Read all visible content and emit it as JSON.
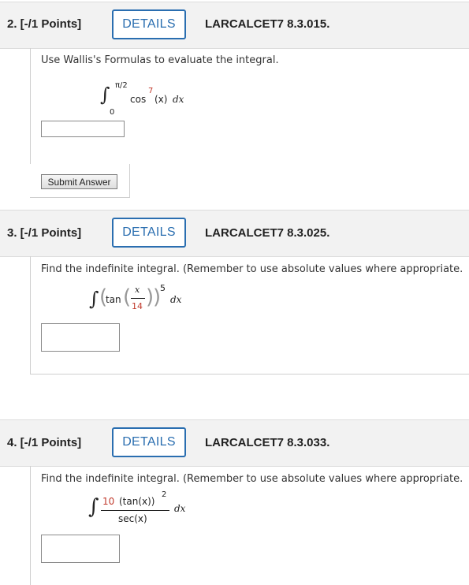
{
  "questions": [
    {
      "points": "2. [-/1 Points]",
      "details_label": "DETAILS",
      "problem_id": "LARCALCET7 8.3.015.",
      "prompt": "Use Wallis's Formulas to evaluate the integral.",
      "integral": {
        "upper": "π/2",
        "lower": "0",
        "func": "cos",
        "exponent": "7",
        "arg": "(x)",
        "dx": "dx"
      },
      "submit_label": "Submit Answer",
      "answer_value": ""
    },
    {
      "points": "3. [-/1 Points]",
      "details_label": "DETAILS",
      "problem_id": "LARCALCET7 8.3.025.",
      "prompt": "Find the indefinite integral. (Remember to use absolute values where appropriate.",
      "integral": {
        "func": "tan",
        "numerator": "x",
        "denominator": "14",
        "exponent": "5",
        "dx": "dx"
      },
      "answer_value": ""
    },
    {
      "points": "4. [-/1 Points]",
      "details_label": "DETAILS",
      "problem_id": "LARCALCET7 8.3.033.",
      "prompt": "Find the indefinite integral. (Remember to use absolute values where appropriate.",
      "integral": {
        "coef": "10",
        "numerator_expr": "(tan(x))",
        "exponent": "2",
        "denominator": "sec(x)",
        "dx": "dx"
      },
      "answer_value": ""
    }
  ],
  "colors": {
    "accent": "#2a6eb0",
    "header_bg": "#f2f2f2",
    "highlight": "#c0392b"
  }
}
